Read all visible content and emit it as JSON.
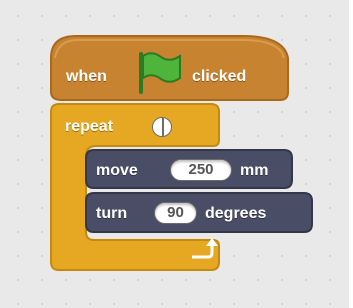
{
  "hat_block": {
    "text_before": "when",
    "text_after": "clicked",
    "icon": "green-flag-icon",
    "color": "#c88330"
  },
  "repeat_block": {
    "label": "repeat",
    "color": "#e6a822"
  },
  "motion_blocks": [
    {
      "keyword": "move",
      "value": "250",
      "unit": "mm"
    },
    {
      "keyword": "turn",
      "value": "90",
      "unit": "degrees"
    }
  ],
  "motion_color": "#4a4d66",
  "loop_arrow_icon": "loop-arrow-icon"
}
